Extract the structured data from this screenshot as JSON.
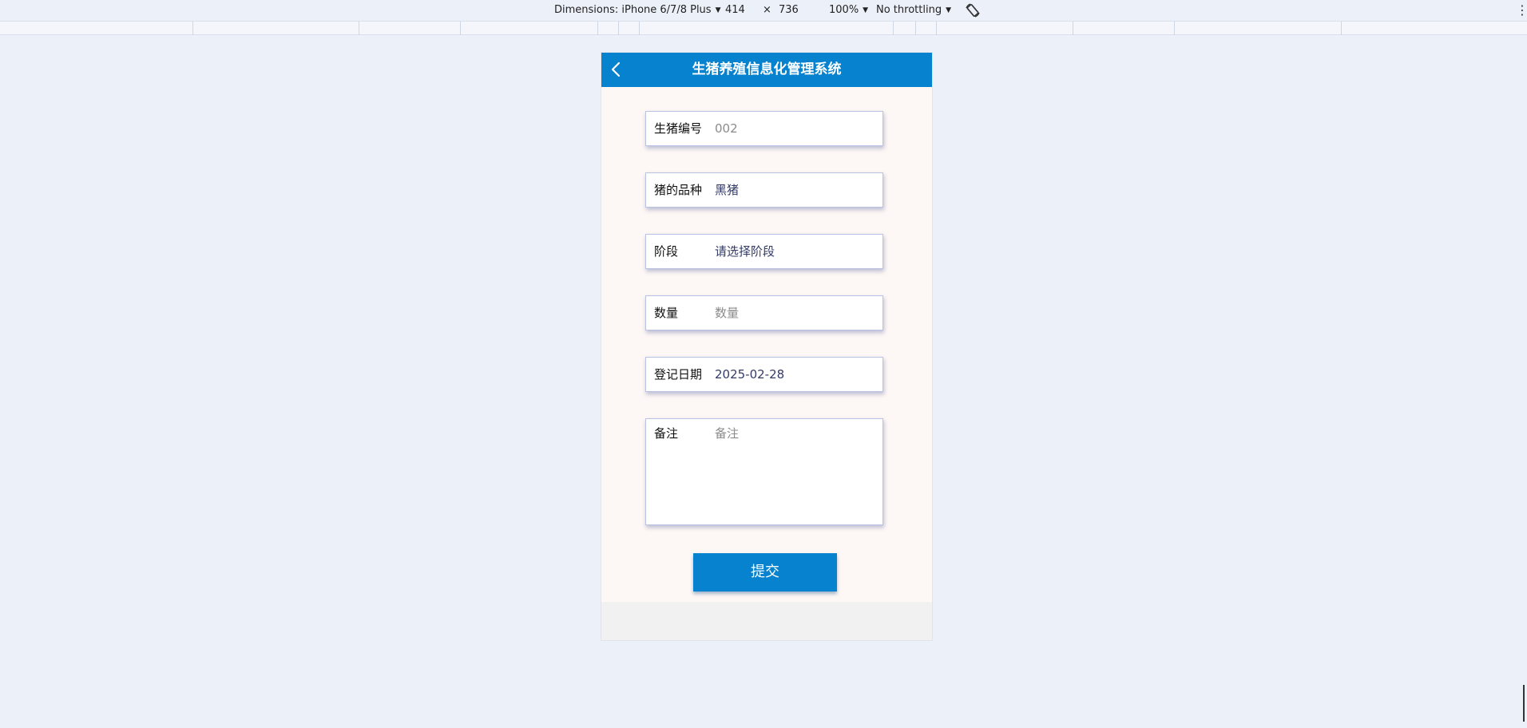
{
  "devtools": {
    "dimensions_label": "Dimensions: iPhone 6/7/8 Plus",
    "width": "414",
    "times": "×",
    "height": "736",
    "zoom": "100%",
    "throttling": "No throttling",
    "caret": "▼",
    "kebab": "⋮"
  },
  "app": {
    "title": "生猪养殖信息化管理系统",
    "header_color": "#0682cf"
  },
  "form": {
    "fields": [
      {
        "label": "生猪编号",
        "value": "002",
        "is_placeholder": false
      },
      {
        "label": "猪的品种",
        "value": "黑猪",
        "is_placeholder": false
      },
      {
        "label": "阶段",
        "value": "请选择阶段",
        "is_placeholder": false
      },
      {
        "label": "数量",
        "value": "",
        "placeholder": "数量",
        "is_placeholder": true
      },
      {
        "label": "登记日期",
        "value": "2025-02-28",
        "is_placeholder": false
      },
      {
        "label": "备注",
        "value": "",
        "placeholder": "备注",
        "is_placeholder": true
      }
    ],
    "submit_label": "提交"
  }
}
